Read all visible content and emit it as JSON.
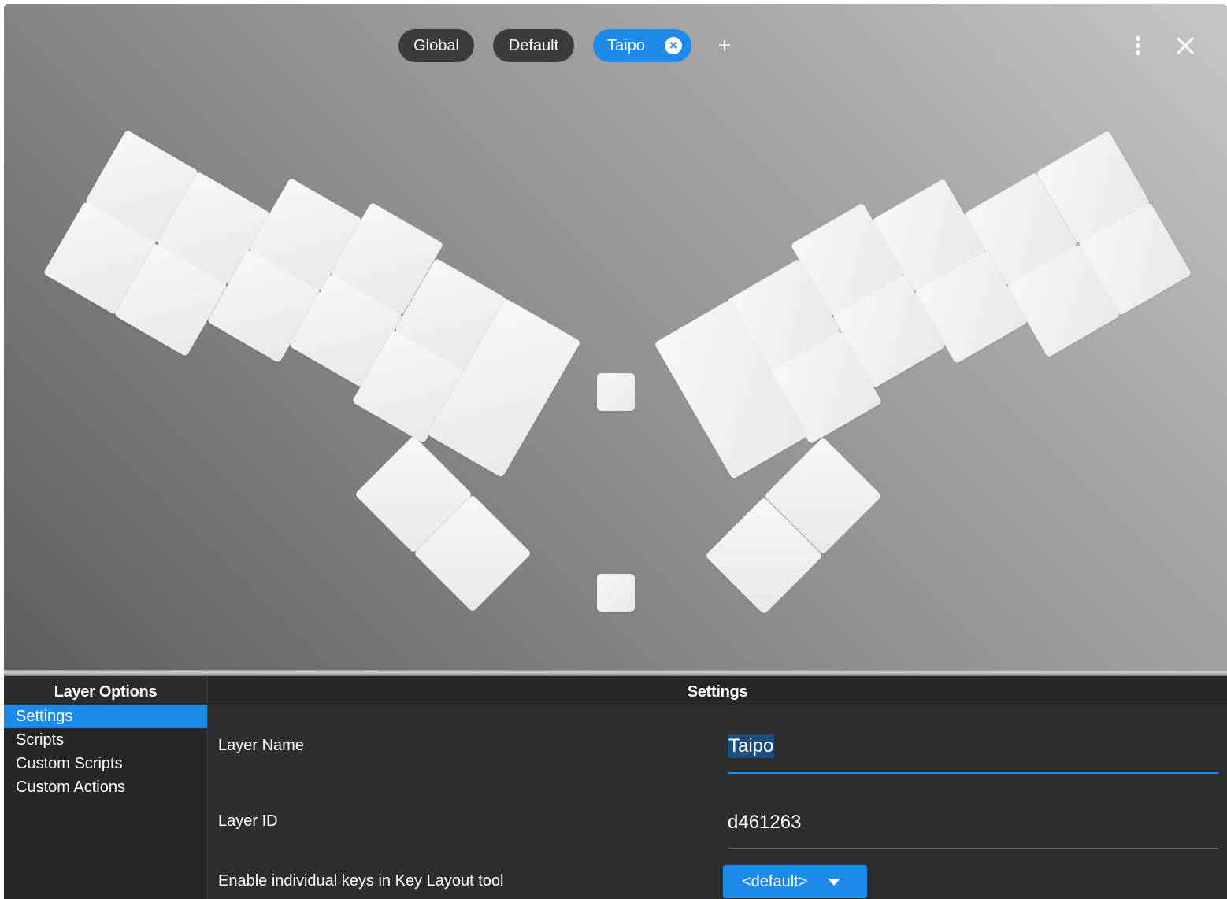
{
  "layer_tabs": {
    "tabs": [
      {
        "label": "Global",
        "active": false
      },
      {
        "label": "Default",
        "active": false
      },
      {
        "label": "Taipo",
        "active": true
      }
    ],
    "add_label": "+"
  },
  "colors": {
    "accent": "#1e8bea",
    "chip_inactive": "#3b3b3b",
    "key": "#f2f2f2",
    "panel_bg": "#2c2c2c"
  },
  "icons": {
    "menu": "more-vertical-icon",
    "close": "close-icon",
    "tab_close": "close-circle-icon",
    "dropdown": "caret-down-icon"
  },
  "layer_options": {
    "title": "Layer Options",
    "items": [
      {
        "label": "Settings",
        "selected": true
      },
      {
        "label": "Scripts",
        "selected": false
      },
      {
        "label": "Custom Scripts",
        "selected": false
      },
      {
        "label": "Custom Actions",
        "selected": false
      }
    ]
  },
  "settings": {
    "title": "Settings",
    "layer_name_label": "Layer Name",
    "layer_name_value": "Taipo",
    "layer_id_label": "Layer ID",
    "layer_id_value": "d461263",
    "enable_keys_label": "Enable individual keys in Key Layout tool",
    "enable_keys_value": "<default>"
  }
}
